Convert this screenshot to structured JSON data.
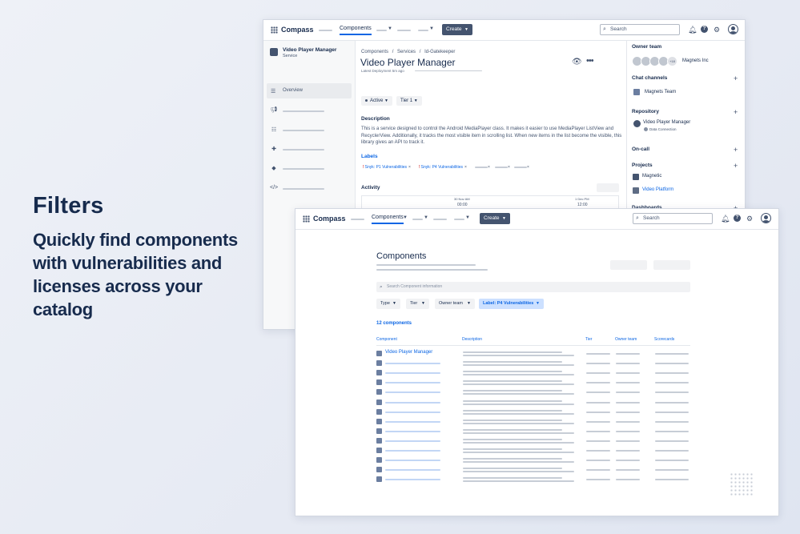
{
  "hero": {
    "title": "Filters",
    "subtitle": "Quickly find components with vulnerabilities and licenses across your catalog"
  },
  "nav": {
    "brand": "Compass",
    "components_tab": "Components",
    "create_label": "Create",
    "search_placeholder": "Search"
  },
  "detail": {
    "sidebar": {
      "title": "Video Player Manager",
      "type": "Service",
      "overview": "Overview"
    },
    "breadcrumb": [
      "Components",
      "/",
      "Services",
      "/",
      "Id-Gatekeeper"
    ],
    "title": "Video Player Manager",
    "deployment": "Latest Deployment 5m ago",
    "status": "Active",
    "tier": "Tier 1",
    "description_heading": "Description",
    "description": "This is a service designed to control the Android MediaPlayer class. It makes it easier to use MediaPlayer ListView and RecyclerView. Additionally, it tracks the most visible item in scrolling list. When new items in the list become the visible, this library gives an API to track it.",
    "labels_heading": "Labels",
    "labels": [
      "Snyk: P1 Vulnerabilities",
      "Snyk: P4 Vulnerabilities"
    ],
    "activity_heading": "Activity",
    "activity_dates": [
      {
        "date": "30 Nov AM",
        "time": "00:00"
      },
      {
        "date": "1 Dec PM",
        "time": "12:00"
      }
    ],
    "right_panel": {
      "owner_team": "Owner team",
      "owner_more": "+18",
      "owner_name": "Magnets Inc",
      "chat_channels": "Chat channels",
      "chat_name": "Magnets Team",
      "repository": "Repository",
      "repo_name": "Video Player Manager",
      "repo_connection": "Data Connection",
      "on_call": "On-call",
      "projects": "Projects",
      "project_1": "Magnetic",
      "project_2": "Video Platform",
      "dashboards": "Dashboards"
    }
  },
  "list": {
    "title": "Components",
    "search_placeholder": "Search Component information",
    "filters": {
      "type": "Type",
      "tier": "Tier",
      "owner_team": "Owner team",
      "label": "Label: P4 Vulnerabilities"
    },
    "count": "12 components",
    "columns": {
      "component": "Component",
      "description": "Description",
      "tier": "Tier",
      "owner_team": "Owner team",
      "scorecards": "Scorecards"
    },
    "first_row": "Video Player Manager"
  },
  "colors": {
    "accent": "#0c66e4",
    "text": "#172b4d",
    "create_button": "#44546f",
    "filter_selected_bg": "#cce0ff"
  }
}
